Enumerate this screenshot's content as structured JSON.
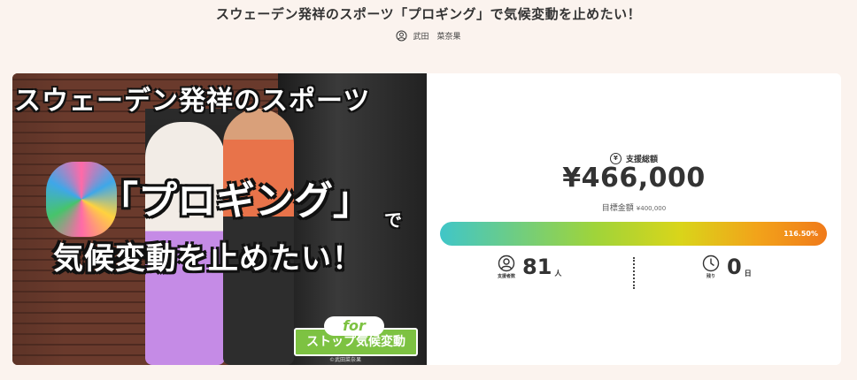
{
  "project": {
    "title": "スウェーデン発祥のスポーツ「プロギング」で気候変動を止めたい！",
    "owner_name": "武田　菜奈果"
  },
  "hero": {
    "line1": "スウェーデン発祥のスポーツ",
    "line2": "「プロギング」",
    "line2_suffix": "で",
    "line3": "気候変動を止めたい！",
    "for_label": "for",
    "badge": "ストップ気候変動",
    "credit": "©武田菜奈果"
  },
  "funding": {
    "label": "支援総額",
    "amount": "¥466,000",
    "goal_label": "目標金額",
    "goal_value": "¥400,000",
    "progress_text": "116.50%",
    "progress_fraction": 1.165
  },
  "stats": {
    "supporters_caption": "支援者数",
    "supporters_value": "81",
    "supporters_unit": "人",
    "remaining_caption": "残り",
    "remaining_value": "0",
    "remaining_unit": "日"
  },
  "icons": {
    "owner": "user-circle-icon",
    "yen": "yen-circle-icon",
    "supporters": "user-circle-icon",
    "clock": "clock-icon"
  },
  "colors": {
    "background": "#fbf3ee",
    "badge_green": "#7dc242",
    "progress_start": "#40c6c8",
    "progress_end": "#f07a1a"
  }
}
